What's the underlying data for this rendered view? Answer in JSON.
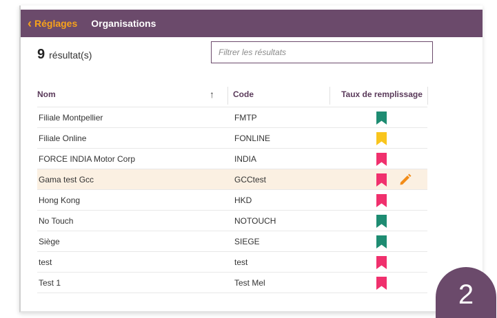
{
  "header": {
    "back_label": "Réglages",
    "title": "Organisations",
    "bar_color": "#6b4a6b",
    "back_color": "#f7a21b"
  },
  "results": {
    "count": "9",
    "label": "résultat(s)"
  },
  "filter": {
    "placeholder": "Filtrer les résultats",
    "value": ""
  },
  "table": {
    "columns": {
      "name": "Nom",
      "code": "Code",
      "fill_rate": "Taux de remplissage",
      "sort_indicator": "↑"
    },
    "rows": [
      {
        "name": "Filiale Montpellier",
        "code": "FMTP",
        "fill_color": "#1e8c72",
        "highlighted": false
      },
      {
        "name": "Filiale Online",
        "code": "FONLINE",
        "fill_color": "#f9c51d",
        "highlighted": false
      },
      {
        "name": "FORCE INDIA Motor Corp",
        "code": "INDIA",
        "fill_color": "#f0306d",
        "highlighted": false
      },
      {
        "name": "Gama test Gcc",
        "code": "GCCtest",
        "fill_color": "#f0306d",
        "highlighted": true
      },
      {
        "name": "Hong Kong",
        "code": "HKD",
        "fill_color": "#f0306d",
        "highlighted": false
      },
      {
        "name": "No Touch",
        "code": "NOTOUCH",
        "fill_color": "#1e8c72",
        "highlighted": false
      },
      {
        "name": "Siège",
        "code": "SIEGE",
        "fill_color": "#1e8c72",
        "highlighted": false
      },
      {
        "name": "test",
        "code": "test",
        "fill_color": "#f0306d",
        "highlighted": false
      },
      {
        "name": "Test 1",
        "code": "Test Mel",
        "fill_color": "#f0306d",
        "highlighted": false
      }
    ],
    "edit_icon": "pencil-icon",
    "edit_color": "#f28c18",
    "highlight_color": "#fbf0e2"
  },
  "step_badge": "2"
}
